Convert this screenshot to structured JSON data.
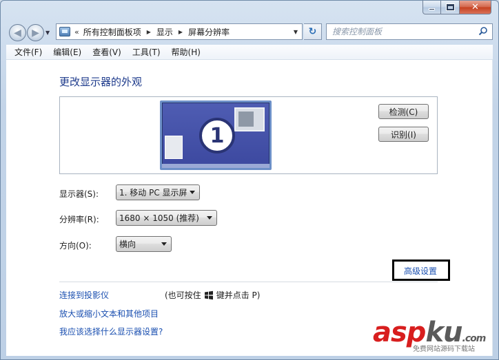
{
  "window": {
    "caption": {
      "close_glyph": "✕"
    }
  },
  "nav": {
    "back_glyph": "◀",
    "forward_glyph": "▶",
    "refresh_glyph": "↻"
  },
  "address": {
    "chevron": "«",
    "crumbs": [
      "所有控制面板项",
      "显示",
      "屏幕分辨率"
    ]
  },
  "search": {
    "placeholder": "搜索控制面板"
  },
  "menu": [
    "文件(F)",
    "编辑(E)",
    "查看(V)",
    "工具(T)",
    "帮助(H)"
  ],
  "page": {
    "heading": "更改显示器的外观",
    "monitor_number": "1",
    "detect_button": "检测(C)",
    "identify_button": "识别(I)",
    "display_label": "显示器(S):",
    "display_value": "1. 移动 PC 显示屏",
    "resolution_label": "分辨率(R):",
    "resolution_value": "1680 × 1050 (推荐)",
    "orientation_label": "方向(O):",
    "orientation_value": "横向",
    "advanced_link": "高级设置",
    "projector_link": "连接到投影仪",
    "projector_hint_pre": "(也可按住",
    "projector_hint_post": "键并点击 P)",
    "text_size_link": "放大或缩小文本和其他项目",
    "which_settings_link": "我应该选择什么显示器设置?"
  },
  "watermark": {
    "part1": "asp",
    "part2": "ku",
    "suffix": ".com",
    "sub": "免费网站源码下载站"
  },
  "colors": {
    "link": "#1a4fb0",
    "heading": "#1e3b8c",
    "monitor_bg": "#3c489f",
    "highlight_box": "#000000"
  },
  "icons": [
    "control-panel-icon",
    "search-icon",
    "windows-logo-icon",
    "refresh-icon",
    "back-arrow-icon",
    "forward-arrow-icon"
  ]
}
